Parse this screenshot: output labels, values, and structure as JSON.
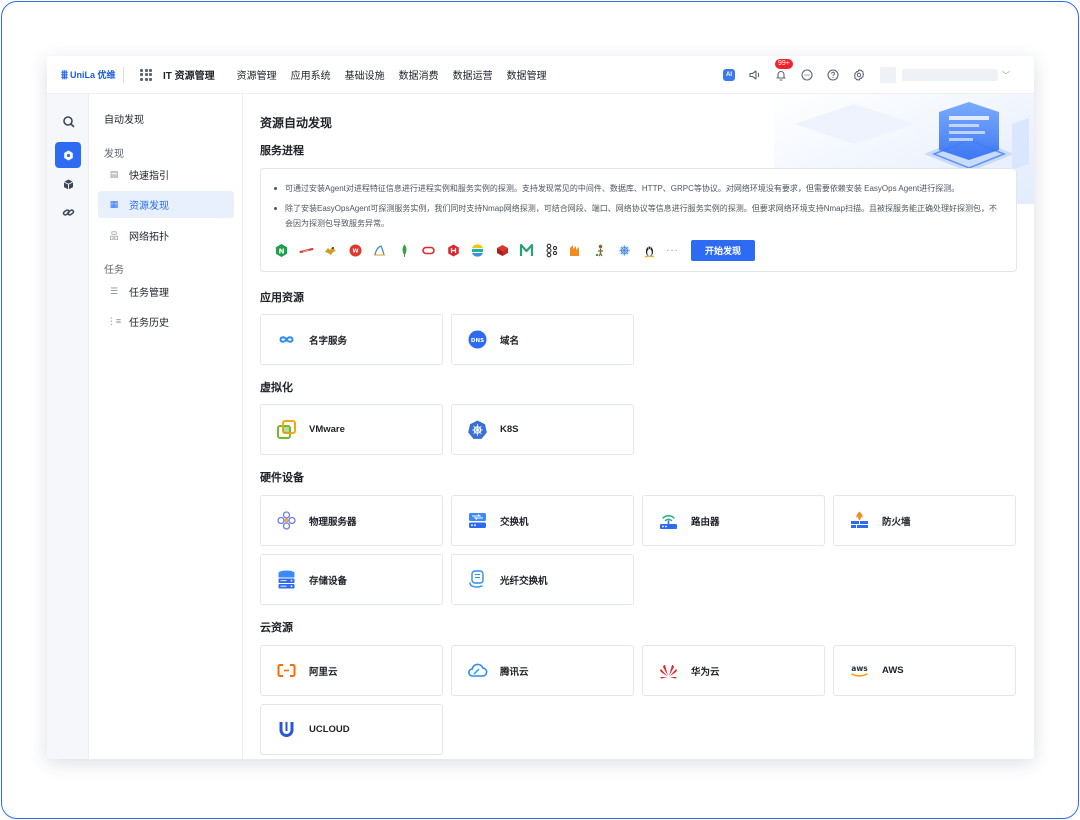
{
  "topbar": {
    "logo_text": "UniLa 优维",
    "app_title": "IT 资源管理",
    "nav": [
      "资源管理",
      "应用系统",
      "基础设施",
      "数据消费",
      "数据运营",
      "数据管理"
    ],
    "ai_label": "AI",
    "notification_count": "99+"
  },
  "submenu": {
    "title": "自动发现",
    "groups": [
      {
        "label": "发现",
        "items": [
          "快速指引",
          "资源发现",
          "网络拓扑"
        ]
      },
      {
        "label": "任务",
        "items": [
          "任务管理",
          "任务历史"
        ]
      }
    ],
    "active_item": "资源发现"
  },
  "main": {
    "page_title": "资源自动发现",
    "service_process": {
      "heading": "服务进程",
      "line1": "可通过安装Agent对进程特征信息进行进程实例和服务实例的探测。支持发现常见的中间件、数据库、HTTP、GRPC等协议。对网络环境没有要求，但需要依赖安装 EasyOps Agent进行探测。",
      "line2": "除了安装EasyOpsAgent可探测服务实例，我们同时支持Nmap网络探测，可结合网段、端口、网络协议等信息进行服务实例的探测。但要求网络环境支持Nmap扫描。且被探服务能正确处理好探测包，不会因为探测包导致服务异常。",
      "ellipsis": "···",
      "start_button": "开始发现",
      "logos": [
        "nginx-icon",
        "redis-icon",
        "tomcat-icon",
        "jvm-icon",
        "mysql-icon",
        "mongodb-icon",
        "oracle-icon",
        "rabbit-icon",
        "elastic-icon",
        "redis-cube-icon",
        "memcached-icon",
        "kafka-icon",
        "activemq-icon",
        "hadoop-icon",
        "k8s-wheel-icon",
        "linux-icon"
      ]
    },
    "sections": [
      {
        "heading": "应用资源",
        "cards": [
          {
            "label": "名字服务",
            "icon": "infinity-icon"
          },
          {
            "label": "域名",
            "icon": "dns-globe-icon"
          }
        ]
      },
      {
        "heading": "虚拟化",
        "cards": [
          {
            "label": "VMware",
            "icon": "vmware-icon"
          },
          {
            "label": "K8S",
            "icon": "kubernetes-icon"
          }
        ]
      },
      {
        "heading": "硬件设备",
        "cards": [
          {
            "label": "物理服务器",
            "icon": "server-cluster-icon"
          },
          {
            "label": "交换机",
            "icon": "switch-icon"
          },
          {
            "label": "路由器",
            "icon": "router-icon"
          },
          {
            "label": "防火墙",
            "icon": "firewall-icon"
          },
          {
            "label": "存储设备",
            "icon": "storage-icon"
          },
          {
            "label": "光纤交换机",
            "icon": "fiber-switch-icon"
          }
        ]
      },
      {
        "heading": "云资源",
        "cards": [
          {
            "label": "阿里云",
            "icon": "aliyun-icon"
          },
          {
            "label": "腾讯云",
            "icon": "tencent-cloud-icon"
          },
          {
            "label": "华为云",
            "icon": "huawei-cloud-icon"
          },
          {
            "label": "AWS",
            "icon": "aws-icon"
          },
          {
            "label": "UCLOUD",
            "icon": "ucloud-icon"
          }
        ]
      }
    ]
  },
  "colors": {
    "accent": "#2d6cf2",
    "badge": "#f5222d"
  }
}
